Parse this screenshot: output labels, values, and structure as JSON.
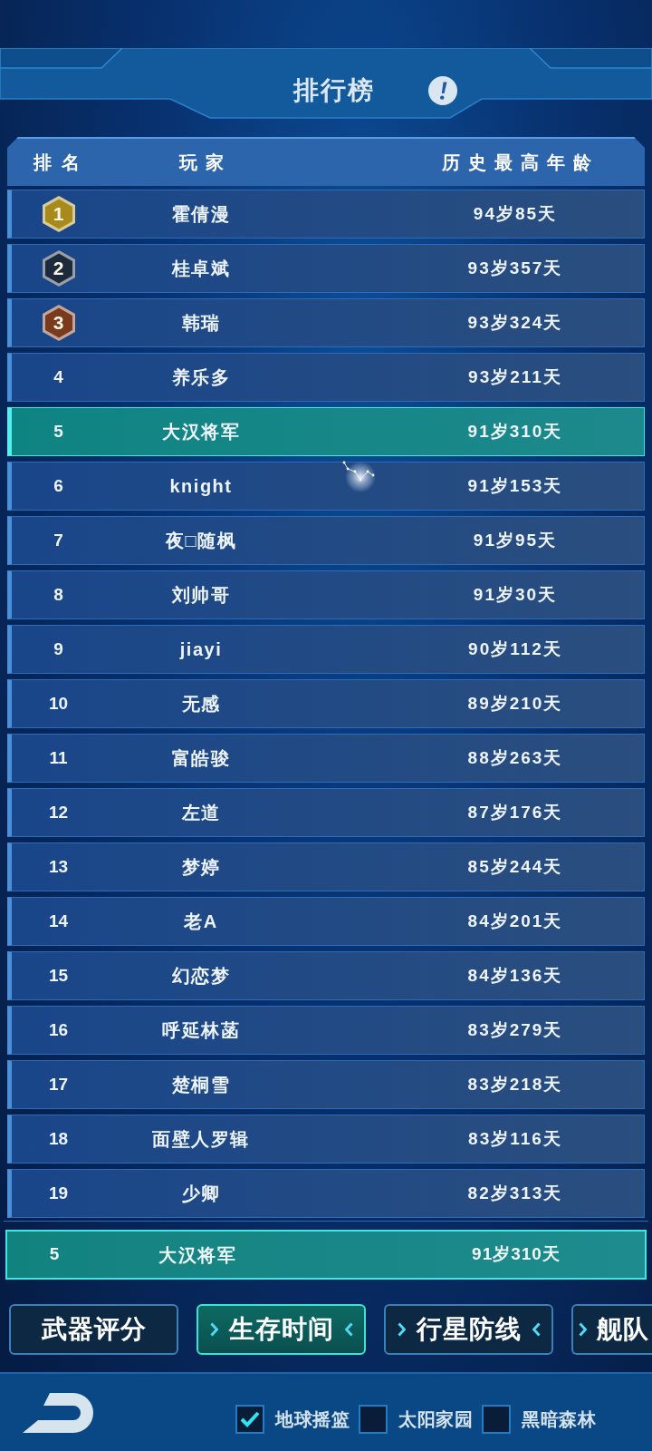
{
  "header": {
    "title": "排行榜"
  },
  "table": {
    "columns": [
      "排名",
      "玩家",
      "历史最高年龄"
    ],
    "rows": [
      {
        "kind": "medal",
        "rank": "1",
        "color": "#a88a1c",
        "player": "霍倩漫",
        "age": "94岁85天",
        "highlighted": false
      },
      {
        "kind": "medal",
        "rank": "2",
        "color": "#1c2a3c",
        "player": "桂卓斌",
        "age": "93岁357天",
        "highlighted": false
      },
      {
        "kind": "medal",
        "rank": "3",
        "color": "#7a3a1e",
        "player": "韩瑞",
        "age": "93岁324天",
        "highlighted": false
      },
      {
        "kind": "plain",
        "rank": "4",
        "player": "养乐多",
        "age": "93岁211天",
        "highlighted": false
      },
      {
        "kind": "plain",
        "rank": "5",
        "player": "大汉将军",
        "age": "91岁310天",
        "highlighted": true
      },
      {
        "kind": "plain",
        "rank": "6",
        "player": "knight",
        "age": "91岁153天",
        "highlighted": false
      },
      {
        "kind": "plain",
        "rank": "7",
        "player": "夜□随枫",
        "age": "91岁95天",
        "highlighted": false
      },
      {
        "kind": "plain",
        "rank": "8",
        "player": "刘帅哥",
        "age": "91岁30天",
        "highlighted": false
      },
      {
        "kind": "plain",
        "rank": "9",
        "player": "jiayi",
        "age": "90岁112天",
        "highlighted": false
      },
      {
        "kind": "plain",
        "rank": "10",
        "player": "无感",
        "age": "89岁210天",
        "highlighted": false
      },
      {
        "kind": "plain",
        "rank": "11",
        "player": "富皓骏",
        "age": "88岁263天",
        "highlighted": false
      },
      {
        "kind": "plain",
        "rank": "12",
        "player": "左道",
        "age": "87岁176天",
        "highlighted": false
      },
      {
        "kind": "plain",
        "rank": "13",
        "player": "梦婷",
        "age": "85岁244天",
        "highlighted": false
      },
      {
        "kind": "plain",
        "rank": "14",
        "player": "老A",
        "age": "84岁201天",
        "highlighted": false
      },
      {
        "kind": "plain",
        "rank": "15",
        "player": "幻恋梦",
        "age": "84岁136天",
        "highlighted": false
      },
      {
        "kind": "plain",
        "rank": "16",
        "player": "呼延林菡",
        "age": "83岁279天",
        "highlighted": false
      },
      {
        "kind": "plain",
        "rank": "17",
        "player": "楚桐雪",
        "age": "83岁218天",
        "highlighted": false
      },
      {
        "kind": "plain",
        "rank": "18",
        "player": "面壁人罗辑",
        "age": "83岁116天",
        "highlighted": false
      },
      {
        "kind": "plain",
        "rank": "19",
        "player": "少卿",
        "age": "82岁313天",
        "highlighted": false
      }
    ]
  },
  "my_entry": {
    "rank": "5",
    "player": "大汉将军",
    "age": "91岁310天"
  },
  "tabs": [
    {
      "label": "武器评分",
      "selected": false,
      "left_arrow": false,
      "right_arrow": false
    },
    {
      "label": "生存时间",
      "selected": true,
      "left_arrow": true,
      "right_arrow": true
    },
    {
      "label": "行星防线",
      "selected": false,
      "left_arrow": true,
      "right_arrow": true
    },
    {
      "label": "舰队",
      "selected": false,
      "left_arrow": true,
      "right_arrow": false
    }
  ],
  "filters": [
    {
      "label": "地球摇篮",
      "checked": true
    },
    {
      "label": "太阳家园",
      "checked": false
    },
    {
      "label": "黑暗森林",
      "checked": false
    }
  ]
}
